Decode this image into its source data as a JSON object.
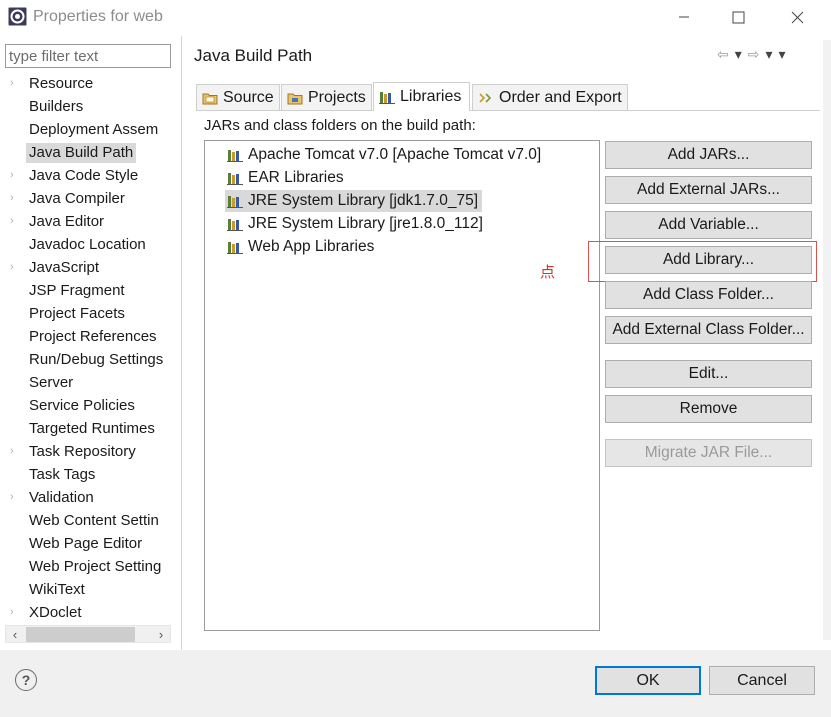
{
  "window": {
    "title": "Properties for web",
    "controls": {
      "minimize": "—",
      "maximize": "☐",
      "close": "✕"
    }
  },
  "left_pane": {
    "filter_placeholder": "type filter text",
    "selected": "Java Build Path",
    "items": [
      {
        "label": "Resource",
        "expandable": true
      },
      {
        "label": "Builders",
        "expandable": false
      },
      {
        "label": "Deployment Assem",
        "expandable": false
      },
      {
        "label": "Java Build Path",
        "expandable": false
      },
      {
        "label": "Java Code Style",
        "expandable": true
      },
      {
        "label": "Java Compiler",
        "expandable": true
      },
      {
        "label": "Java Editor",
        "expandable": true
      },
      {
        "label": "Javadoc Location",
        "expandable": false
      },
      {
        "label": "JavaScript",
        "expandable": true
      },
      {
        "label": "JSP Fragment",
        "expandable": false
      },
      {
        "label": "Project Facets",
        "expandable": false
      },
      {
        "label": "Project References",
        "expandable": false
      },
      {
        "label": "Run/Debug Settings",
        "expandable": false
      },
      {
        "label": "Server",
        "expandable": false
      },
      {
        "label": "Service Policies",
        "expandable": false
      },
      {
        "label": "Targeted Runtimes",
        "expandable": false
      },
      {
        "label": "Task Repository",
        "expandable": true
      },
      {
        "label": "Task Tags",
        "expandable": false
      },
      {
        "label": "Validation",
        "expandable": true
      },
      {
        "label": "Web Content Settin",
        "expandable": false
      },
      {
        "label": "Web Page Editor",
        "expandable": false
      },
      {
        "label": "Web Project Setting",
        "expandable": false
      },
      {
        "label": "WikiText",
        "expandable": false
      },
      {
        "label": "XDoclet",
        "expandable": true
      }
    ],
    "scroll": {
      "left": "‹",
      "right": "›"
    }
  },
  "page": {
    "title": "Java Build Path",
    "nav": {
      "back": "⇦",
      "back_menu": "▾",
      "forward": "⇨",
      "forward_menu": "▾",
      "view_menu": "▾"
    }
  },
  "tabs": [
    {
      "label": "Source",
      "icon": "source-folder-icon",
      "active": false
    },
    {
      "label": "Projects",
      "icon": "projects-icon",
      "active": false
    },
    {
      "label": "Libraries",
      "icon": "libraries-icon",
      "active": true
    },
    {
      "label": "Order and Export",
      "icon": "order-export-icon",
      "active": false
    }
  ],
  "libraries": {
    "heading": "JARs and class folders on the build path:",
    "items": [
      {
        "label": "Apache Tomcat v7.0 [Apache Tomcat v7.0]",
        "selected": false
      },
      {
        "label": "EAR Libraries",
        "selected": false
      },
      {
        "label": "JRE System Library [jdk1.7.0_75]",
        "selected": true
      },
      {
        "label": "JRE System Library [jre1.8.0_112]",
        "selected": false
      },
      {
        "label": "Web App Libraries",
        "selected": false
      }
    ]
  },
  "annotation": {
    "text": "点",
    "color": "#d0352a"
  },
  "buttons": {
    "add_jars": "Add JARs...",
    "add_external_jars": "Add External JARs...",
    "add_variable": "Add Variable...",
    "add_library": "Add Library...",
    "add_class_folder": "Add Class Folder...",
    "add_external_class_folder": "Add External Class Folder...",
    "edit": "Edit...",
    "remove": "Remove",
    "migrate_jar": "Migrate JAR File..."
  },
  "dialog": {
    "help": "?",
    "ok": "OK",
    "cancel": "Cancel"
  },
  "colors": {
    "accent": "#0078d7",
    "selection": "#d9d9d9",
    "highlight": "#d9534f"
  }
}
